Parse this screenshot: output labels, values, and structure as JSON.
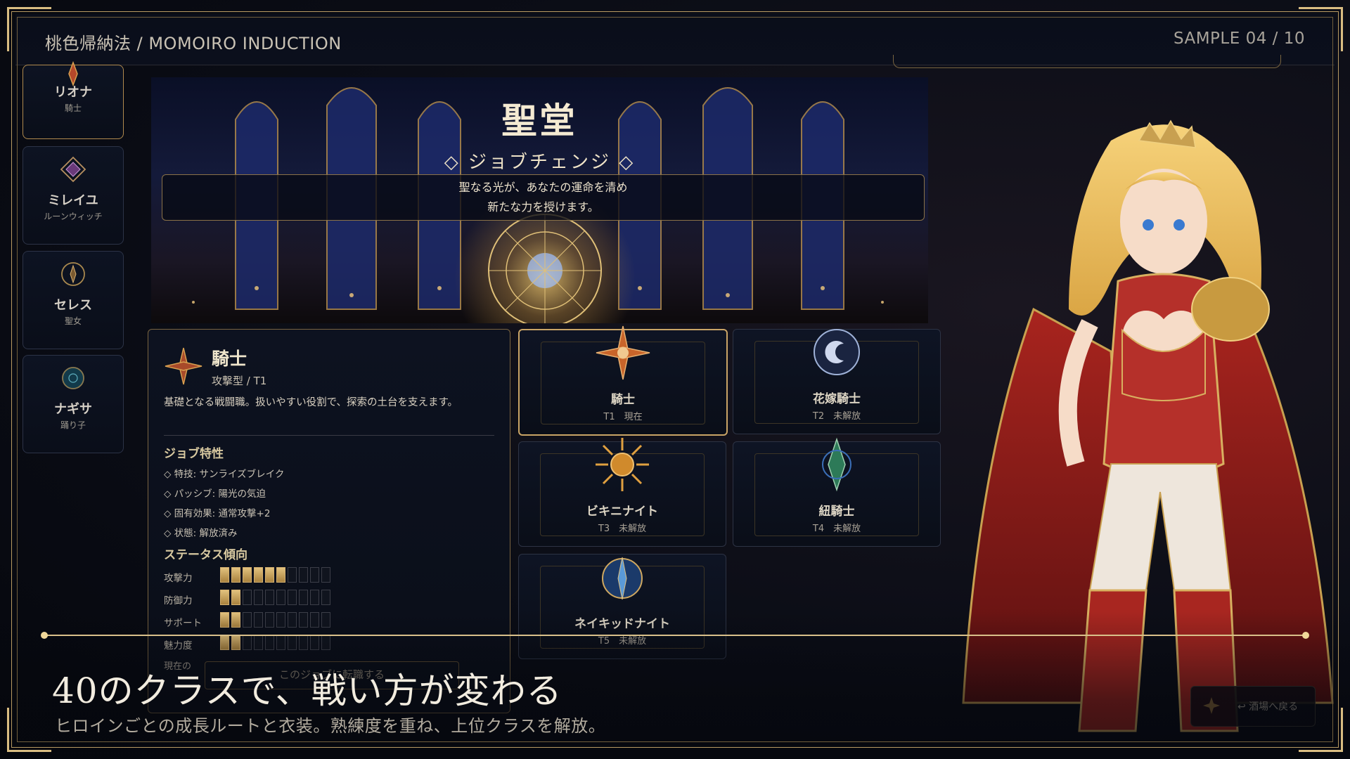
{
  "topbar": {
    "title": "桃色帰納法 / MOMOIRO INDUCTION",
    "counter": "SAMPLE 04 / 10"
  },
  "roster": [
    {
      "name": "リオナ",
      "class": "騎士",
      "active": true
    },
    {
      "name": "ミレイユ",
      "class": "ルーンウィッチ",
      "active": false
    },
    {
      "name": "セレス",
      "class": "聖女",
      "active": false
    },
    {
      "name": "ナギサ",
      "class": "踊り子",
      "active": false
    }
  ],
  "scene": {
    "title": "聖堂",
    "subtitle": "◇ ジョブチェンジ ◇",
    "message_line1": "聖なる光が、あなたの運命を清め",
    "message_line2": "新たな力を授けます。"
  },
  "detail": {
    "job_name": "騎士",
    "job_type": "攻撃型 / T1",
    "description": "基礎となる戦闘職。扱いやすい役割で、探索の土台を支えます。",
    "traits_heading": "ジョブ特性",
    "traits": [
      "◇ 特技: サンライズブレイク",
      "◇ パッシブ: 陽光の気迫",
      "◇ 固有効果: 通常攻撃+2",
      "◇ 状態: 解放済み"
    ],
    "stats_heading": "ステータス傾向",
    "stats": [
      {
        "label": "攻撃力",
        "level": 6,
        "max": 10
      },
      {
        "label": "防御力",
        "level": 2,
        "max": 10
      },
      {
        "label": "サポート",
        "level": 2,
        "max": 10
      },
      {
        "label": "魅力度",
        "level": 2,
        "max": 10
      }
    ],
    "current_label": "現在の",
    "change_button": "このジョブに転職する"
  },
  "jobs": [
    {
      "name": "騎士",
      "tier_status": "T1　現在",
      "current": true,
      "color": "#d9792c"
    },
    {
      "name": "花嫁騎士",
      "tier_status": "T2　未解放",
      "current": false,
      "color": "#8fa6d6"
    },
    {
      "name": "ビキニナイト",
      "tier_status": "T3　未解放",
      "current": false,
      "color": "#d08a2c"
    },
    {
      "name": "紐騎士",
      "tier_status": "T4　未解放",
      "current": false,
      "color": "#3b8f6a"
    },
    {
      "name": "ネイキッドナイト",
      "tier_status": "T5　未解放",
      "current": false,
      "color": "#3b6fb8"
    }
  ],
  "back_button": "↩ 酒場へ戻る",
  "caption": {
    "title": "40のクラスで、戦い方が変わる",
    "subtitle": "ヒロインごとの成長ルートと衣装。熟練度を重ね、上位クラスを解放。"
  },
  "colors": {
    "accent_gold": "#c9a466",
    "background": "#070a12",
    "heroine_red": "#b5302a"
  }
}
